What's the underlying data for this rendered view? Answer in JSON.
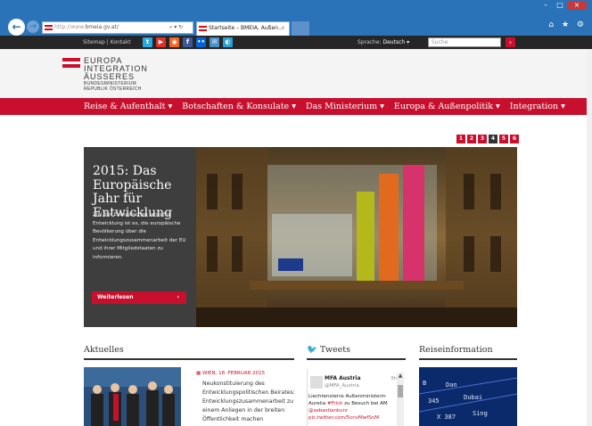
{
  "browser": {
    "url_scheme": "http://www.",
    "url_host": "bmeia.gv.at/",
    "addr_controls": "⌕ ▾ ↻",
    "tab_title": "Startseite – BMEIA, Außen...",
    "tab_close": "×",
    "back_icon": "arrow-left-icon",
    "forward_icon": "arrow-right-icon",
    "right_icons": "⌂ ★ ⚙",
    "window_controls": [
      "–",
      "□",
      "×"
    ]
  },
  "topbar": {
    "links": "Sitemap | Kontakt",
    "social_icons": [
      "twitter-icon",
      "youtube-icon",
      "rss-icon",
      "facebook-icon",
      "flickr-icon",
      "mail-icon",
      "app-icon"
    ],
    "lang_label": "Sprache:",
    "lang_value": "Deutsch ▾",
    "search_placeholder": "Suche",
    "search_button": "›"
  },
  "logo": {
    "line1": "EUROPA",
    "line2": "INTEGRATION",
    "line3": "ÄUSSERES",
    "line4": "BUNDESMINISTERIUM",
    "line5": "REPUBLIK ÖSTERREICH"
  },
  "mainnav": [
    "Reise & Aufenthalt ▾",
    "Botschaften & Konsulate ▾",
    "Das Ministerium ▾",
    "Europa & Außenpolitik ▾",
    "Integration ▾"
  ],
  "pager": [
    "1",
    "2",
    "3",
    "4",
    "5",
    "6"
  ],
  "pager_active": "4",
  "slide": {
    "title": "2015: Das Europäische Jahr für Entwicklung",
    "text": "Ziel des Europäischen Jahrs für Entwicklung ist es, die europäische Bevölkerung über die Entwicklungszusammenarbeit der EU und ihrer Mitgliedstaaten zu informieren.",
    "button": "Weiterlesen",
    "button_arrow": "›"
  },
  "columns": {
    "aktuelles": "Aktuelles",
    "tweets": "Tweets",
    "reise": "Reiseinformation"
  },
  "news": {
    "date": "WIEN, 18. FEBRUAR 2015",
    "text": "Neukonstituierung des Entwicklungspolitischen Beirates: Entwicklungszusammenarbeit zu einem Anliegen in der breiten Öffentlichkeit machen"
  },
  "tweet": {
    "name": "MFA Austria",
    "handle": "@MFA_Austria",
    "time": "3h",
    "text_plain": "Liechtensteins Außenministerin Aurelia ",
    "hashtag": "#Frick",
    "text_mid": " zu Besuch bei AM ",
    "mention": "@sebastiankurz",
    "link": "pic.twitter.com/5cnvMwfSnM"
  },
  "colors": {
    "red": "#c8102e",
    "dark": "#262626",
    "chrome_blue": "#2b73b9"
  }
}
